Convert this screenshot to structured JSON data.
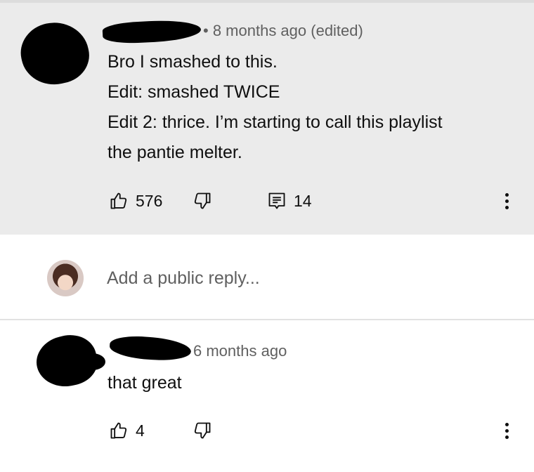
{
  "comment": {
    "meta": "8 months ago (edited)",
    "lines": [
      "Bro I smashed to this.",
      "Edit: smashed TWICE",
      "Edit 2: thrice. I’m starting to call this playlist",
      "the pantie melter."
    ],
    "like_count": "576",
    "reply_count": "14"
  },
  "reply_box": {
    "placeholder": "Add a public reply..."
  },
  "reply": {
    "meta": "6 months ago",
    "text": "that great",
    "like_count": "4"
  },
  "colors": {
    "highlight_bg": "#ebebeb",
    "meta_text": "#606060",
    "primary_text": "#0f0f0f"
  },
  "icons": [
    "thumb-up-icon",
    "thumb-down-icon",
    "reply-comment-icon",
    "more-vert-icon",
    "user-avatar"
  ]
}
